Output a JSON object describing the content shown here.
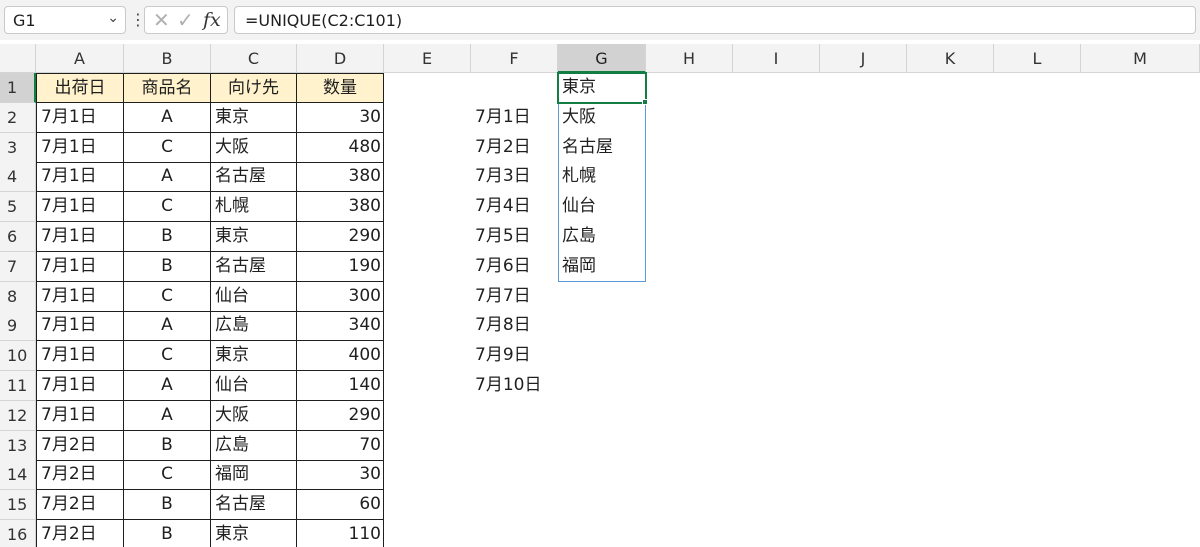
{
  "namebox": {
    "value": "G1",
    "arrow": "⌄"
  },
  "formula_bar": {
    "menu": "⋮",
    "cancel": "✕",
    "enter": "✓",
    "fx": "fx",
    "formula": "=UNIQUE(C2:C101)"
  },
  "columns": [
    "A",
    "B",
    "C",
    "D",
    "E",
    "F",
    "G",
    "H",
    "I",
    "J",
    "K",
    "L",
    "M"
  ],
  "rows": [
    "1",
    "2",
    "3",
    "4",
    "5",
    "6",
    "7",
    "8",
    "9",
    "10",
    "11",
    "12",
    "13",
    "14",
    "15",
    "16"
  ],
  "table": {
    "headers": [
      "出荷日",
      "商品名",
      "向け先",
      "数量"
    ],
    "rows": [
      [
        "7月1日",
        "A",
        "東京",
        "30"
      ],
      [
        "7月1日",
        "C",
        "大阪",
        "480"
      ],
      [
        "7月1日",
        "A",
        "名古屋",
        "380"
      ],
      [
        "7月1日",
        "C",
        "札幌",
        "380"
      ],
      [
        "7月1日",
        "B",
        "東京",
        "290"
      ],
      [
        "7月1日",
        "B",
        "名古屋",
        "190"
      ],
      [
        "7月1日",
        "C",
        "仙台",
        "300"
      ],
      [
        "7月1日",
        "A",
        "広島",
        "340"
      ],
      [
        "7月1日",
        "C",
        "東京",
        "400"
      ],
      [
        "7月1日",
        "A",
        "仙台",
        "140"
      ],
      [
        "7月1日",
        "A",
        "大阪",
        "290"
      ],
      [
        "7月2日",
        "B",
        "広島",
        "70"
      ],
      [
        "7月2日",
        "C",
        "福岡",
        "30"
      ],
      [
        "7月2日",
        "B",
        "名古屋",
        "60"
      ],
      [
        "7月2日",
        "B",
        "東京",
        "110"
      ]
    ]
  },
  "f_column": [
    "7月1日",
    "7月2日",
    "7月3日",
    "7月4日",
    "7月5日",
    "7月6日",
    "7月7日",
    "7月8日",
    "7月9日",
    "7月10日"
  ],
  "g_column": [
    "東京",
    "大阪",
    "名古屋",
    "札幌",
    "仙台",
    "広島",
    "福岡"
  ],
  "colors": {
    "selection": "#137e43",
    "spill_border": "#5b9bd5",
    "header_fill": "#fff2cc"
  }
}
